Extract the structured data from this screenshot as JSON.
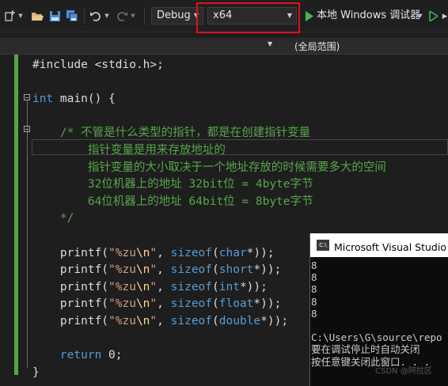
{
  "toolbar": {
    "configuration": "Debug",
    "platform": "x64",
    "debugger_label": "本地 Windows 调试器"
  },
  "scope_bar": {
    "scope": "(全局范围)"
  },
  "code": [
    [
      {
        "t": "#include <stdio.h>;",
        "c": "pl"
      }
    ],
    [],
    [
      {
        "t": "int",
        "c": "kw"
      },
      {
        "t": " main() {",
        "c": "pl"
      }
    ],
    [],
    [
      {
        "t": "    /* 不管是什么类型的指针，都是在创建指针变量",
        "c": "cmt"
      }
    ],
    [
      {
        "t": "        指针变量是用来存放地址的",
        "c": "cmt"
      }
    ],
    [
      {
        "t": "        指针变量的大小取决于一个地址存放的时候需要多大的空间",
        "c": "cmt"
      }
    ],
    [
      {
        "t": "        32位机器上的地址 32bit位 = 4byte字节",
        "c": "cmt"
      }
    ],
    [
      {
        "t": "        64位机器上的地址 64bit位 = 8byte字节",
        "c": "cmt"
      }
    ],
    [
      {
        "t": "    */",
        "c": "cmt"
      }
    ],
    [],
    [
      {
        "t": "    printf(",
        "c": "pl"
      },
      {
        "t": "\"%zu",
        "c": "str"
      },
      {
        "t": "\\n",
        "c": "esc"
      },
      {
        "t": "\"",
        "c": "str"
      },
      {
        "t": ", ",
        "c": "pl"
      },
      {
        "t": "sizeof",
        "c": "kw"
      },
      {
        "t": "(",
        "c": "pl"
      },
      {
        "t": "char",
        "c": "kw"
      },
      {
        "t": "*));",
        "c": "pl"
      }
    ],
    [
      {
        "t": "    printf(",
        "c": "pl"
      },
      {
        "t": "\"%zu",
        "c": "str"
      },
      {
        "t": "\\n",
        "c": "esc"
      },
      {
        "t": "\"",
        "c": "str"
      },
      {
        "t": ", ",
        "c": "pl"
      },
      {
        "t": "sizeof",
        "c": "kw"
      },
      {
        "t": "(",
        "c": "pl"
      },
      {
        "t": "short",
        "c": "kw"
      },
      {
        "t": "*));",
        "c": "pl"
      }
    ],
    [
      {
        "t": "    printf(",
        "c": "pl"
      },
      {
        "t": "\"%zu",
        "c": "str"
      },
      {
        "t": "\\n",
        "c": "esc"
      },
      {
        "t": "\"",
        "c": "str"
      },
      {
        "t": ", ",
        "c": "pl"
      },
      {
        "t": "sizeof",
        "c": "kw"
      },
      {
        "t": "(",
        "c": "pl"
      },
      {
        "t": "int",
        "c": "kw"
      },
      {
        "t": "*));",
        "c": "pl"
      }
    ],
    [
      {
        "t": "    printf(",
        "c": "pl"
      },
      {
        "t": "\"%zu",
        "c": "str"
      },
      {
        "t": "\\n",
        "c": "esc"
      },
      {
        "t": "\"",
        "c": "str"
      },
      {
        "t": ", ",
        "c": "pl"
      },
      {
        "t": "sizeof",
        "c": "kw"
      },
      {
        "t": "(",
        "c": "pl"
      },
      {
        "t": "float",
        "c": "kw"
      },
      {
        "t": "*));",
        "c": "pl"
      }
    ],
    [
      {
        "t": "    printf(",
        "c": "pl"
      },
      {
        "t": "\"%zu",
        "c": "str"
      },
      {
        "t": "\\n",
        "c": "esc"
      },
      {
        "t": "\"",
        "c": "str"
      },
      {
        "t": ", ",
        "c": "pl"
      },
      {
        "t": "sizeof",
        "c": "kw"
      },
      {
        "t": "(",
        "c": "pl"
      },
      {
        "t": "double",
        "c": "kw"
      },
      {
        "t": "*));",
        "c": "pl"
      }
    ],
    [],
    [
      {
        "t": "    return",
        "c": "kw"
      },
      {
        "t": " 0;",
        "c": "pl"
      }
    ],
    [
      {
        "t": "}",
        "c": "pl"
      }
    ]
  ],
  "console": {
    "title": "Microsoft Visual Studio 调",
    "icon_text": "C:\\",
    "lines": [
      "8",
      "8",
      "8",
      "8",
      "8",
      "",
      "C:\\Users\\G\\source\\repo",
      "要在调试停止时自动关闭",
      "按任意键关闭此窗口. . ."
    ]
  },
  "watermark": "CSDN @阿拉区",
  "colors": {
    "comment": "#57a64a",
    "keyword": "#569cd6",
    "string": "#d69d85",
    "escape": "#ffd68f",
    "change_bar": "#57a64a",
    "highlight_box": "#e0121d",
    "run_button": "#3fb950"
  }
}
